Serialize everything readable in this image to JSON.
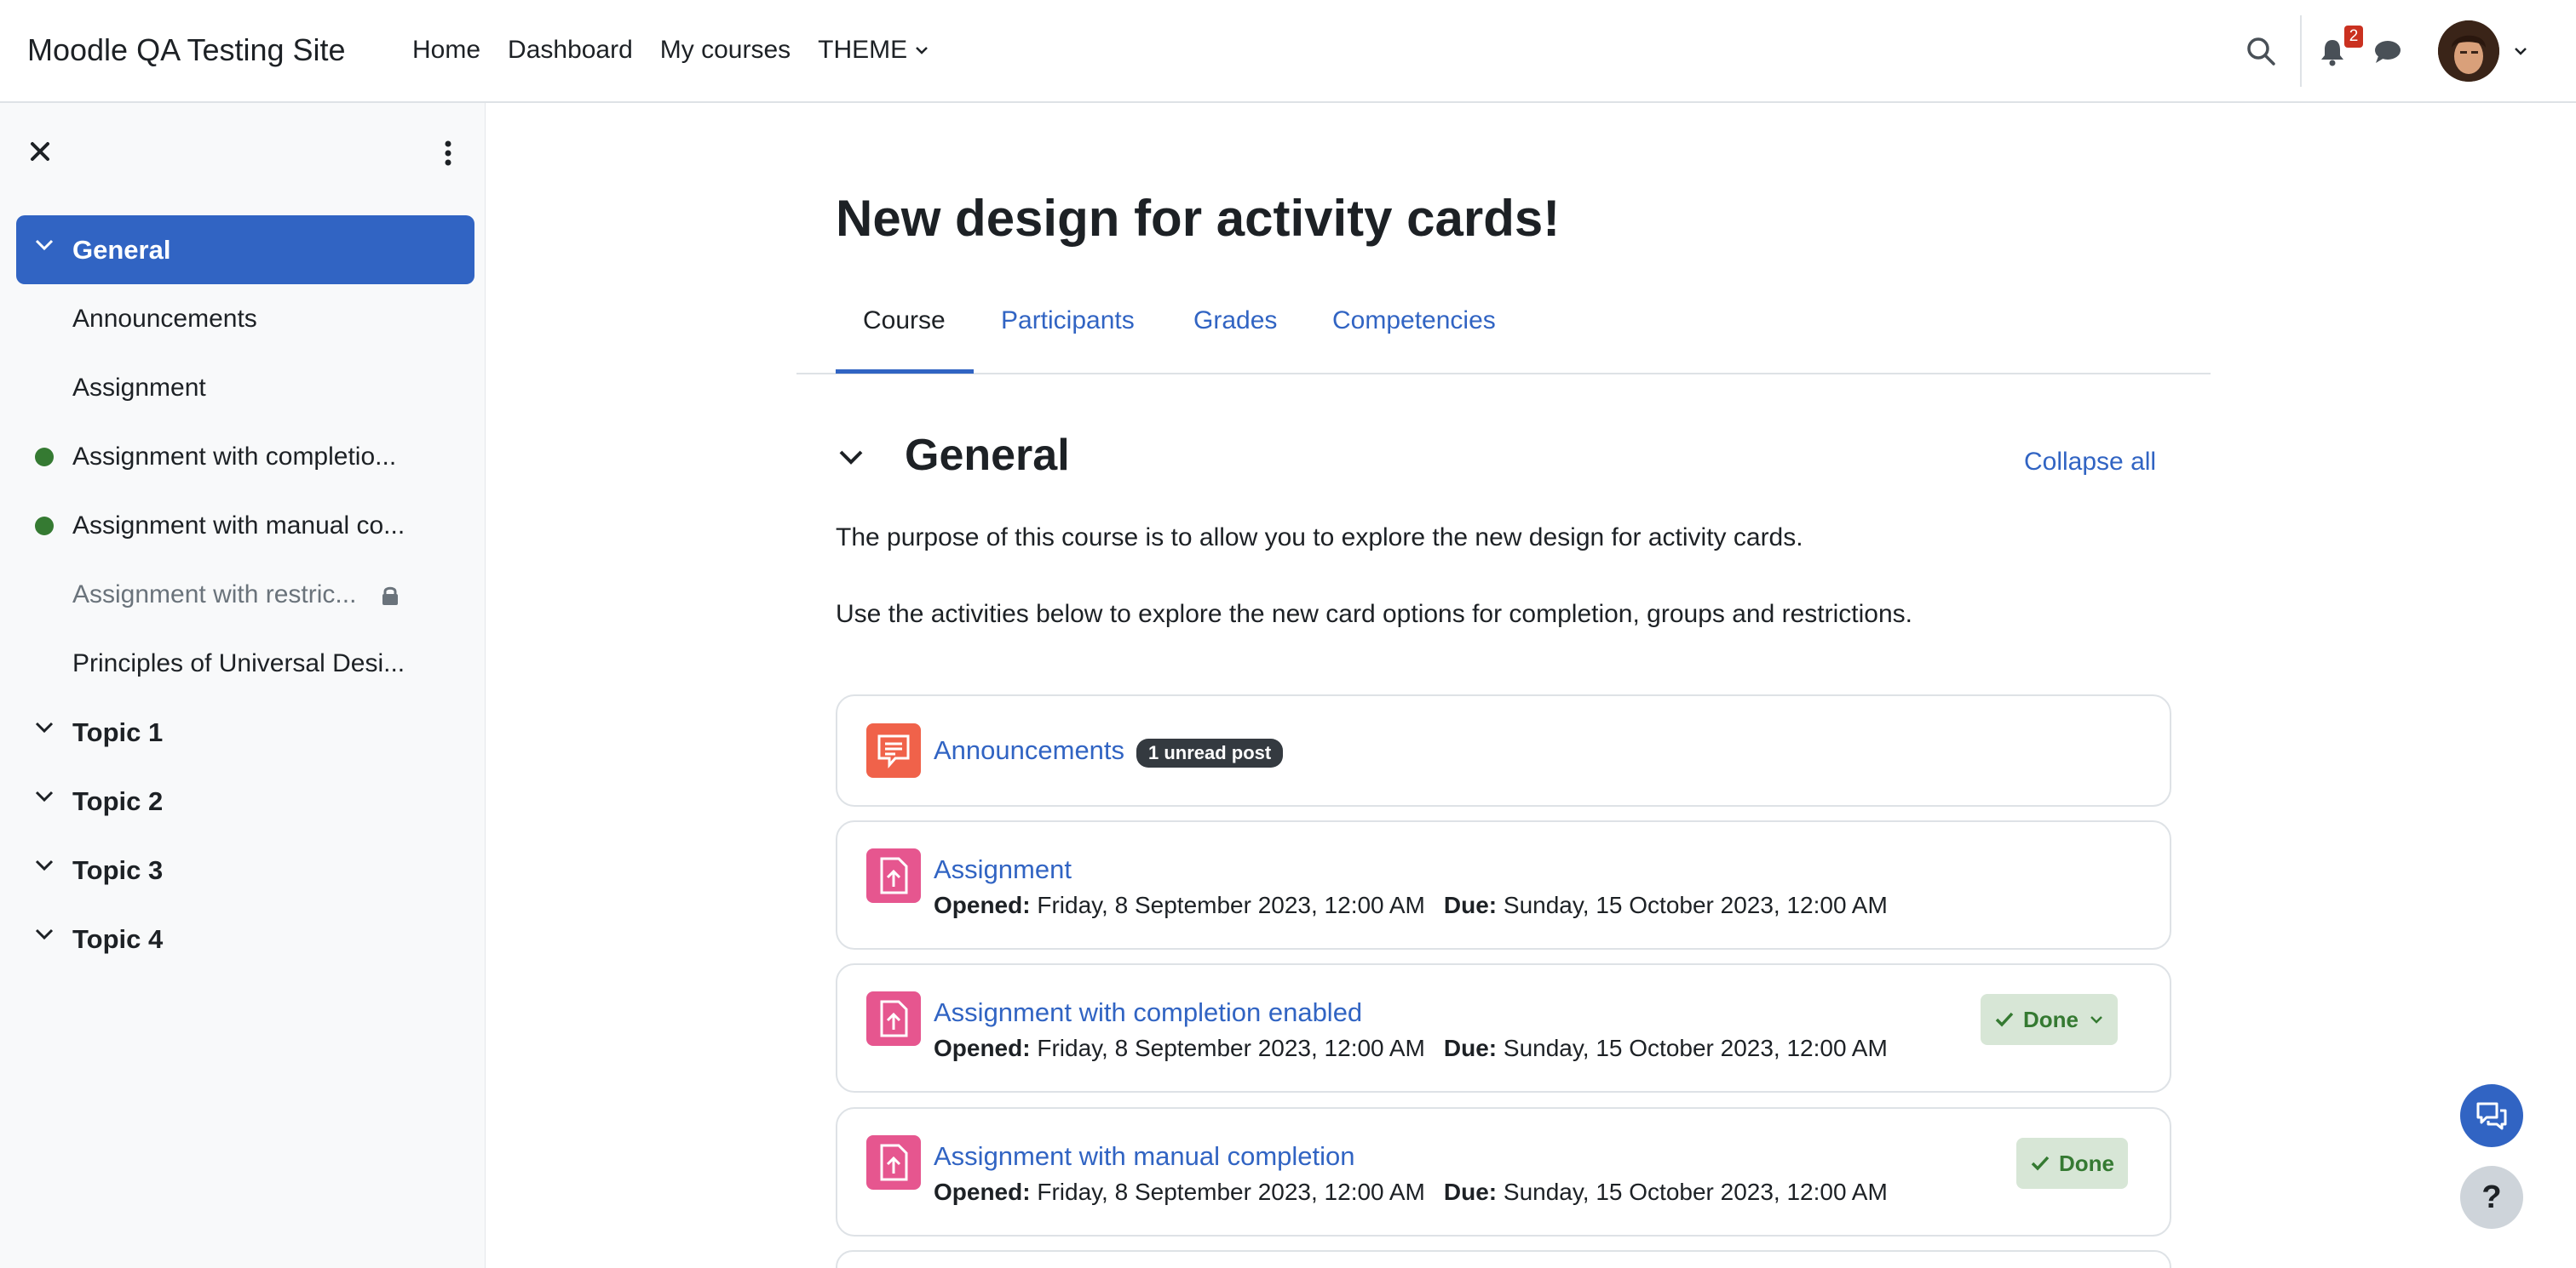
{
  "navbar": {
    "site_name": "Moodle QA Testing Site",
    "links": [
      "Home",
      "Dashboard",
      "My courses",
      "THEME"
    ],
    "notification_count": "2"
  },
  "drawer": {
    "sections": [
      {
        "label": "General",
        "active": true,
        "items": [
          {
            "label": "Announcements",
            "complete": false,
            "restricted": false
          },
          {
            "label": "Assignment",
            "complete": false,
            "restricted": false
          },
          {
            "label": "Assignment with completio...",
            "complete": true,
            "restricted": false
          },
          {
            "label": "Assignment with manual co...",
            "complete": true,
            "restricted": false
          },
          {
            "label": "Assignment with restric...",
            "complete": false,
            "restricted": true
          },
          {
            "label": "Principles of Universal Desi...",
            "complete": false,
            "restricted": false
          }
        ]
      },
      {
        "label": "Topic 1",
        "active": false
      },
      {
        "label": "Topic 2",
        "active": false
      },
      {
        "label": "Topic 3",
        "active": false
      },
      {
        "label": "Topic 4",
        "active": false
      }
    ]
  },
  "main": {
    "title": "New design for activity cards!",
    "tabs": [
      "Course",
      "Participants",
      "Grades",
      "Competencies"
    ],
    "active_tab": "Course",
    "section_title": "General",
    "collapse_all": "Collapse all",
    "summary": [
      "The purpose of this course is to allow you to explore the new design for activity cards.",
      "Use the activities below to explore the new card options for completion, groups and restrictions."
    ],
    "activities": [
      {
        "name": "Announcements",
        "type": "forum",
        "badge": "1 unread post"
      },
      {
        "name": "Assignment",
        "type": "assign",
        "opened_label": "Opened:",
        "opened": "Friday, 8 September 2023, 12:00 AM",
        "due_label": "Due:",
        "due": "Sunday, 15 October 2023, 12:00 AM"
      },
      {
        "name": "Assignment with completion enabled",
        "type": "assign",
        "opened_label": "Opened:",
        "opened": "Friday, 8 September 2023, 12:00 AM",
        "due_label": "Due:",
        "due": "Sunday, 15 October 2023, 12:00 AM",
        "completion": "Done"
      },
      {
        "name": "Assignment with manual completion",
        "type": "assign",
        "opened_label": "Opened:",
        "opened": "Friday, 8 September 2023, 12:00 AM",
        "due_label": "Due:",
        "due": "Sunday, 15 October 2023, 12:00 AM",
        "completion": "Done"
      }
    ]
  },
  "help_label": "?",
  "colors": {
    "primary": "#3164c3",
    "success": "#357a32",
    "forum": "#f0624a",
    "assign": "#e6568f"
  }
}
